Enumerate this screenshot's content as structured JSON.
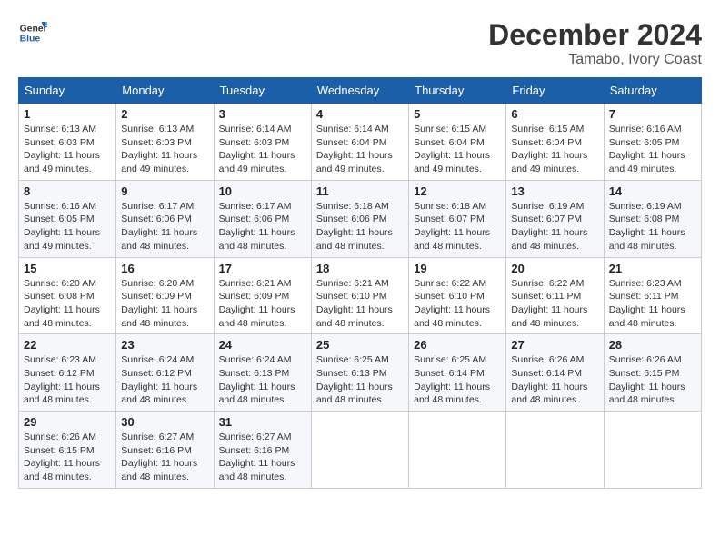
{
  "header": {
    "logo_line1": "General",
    "logo_line2": "Blue",
    "month_year": "December 2024",
    "location": "Tamabo, Ivory Coast"
  },
  "calendar": {
    "days_of_week": [
      "Sunday",
      "Monday",
      "Tuesday",
      "Wednesday",
      "Thursday",
      "Friday",
      "Saturday"
    ],
    "weeks": [
      [
        {
          "day": "1",
          "info": "Sunrise: 6:13 AM\nSunset: 6:03 PM\nDaylight: 11 hours\nand 49 minutes."
        },
        {
          "day": "2",
          "info": "Sunrise: 6:13 AM\nSunset: 6:03 PM\nDaylight: 11 hours\nand 49 minutes."
        },
        {
          "day": "3",
          "info": "Sunrise: 6:14 AM\nSunset: 6:03 PM\nDaylight: 11 hours\nand 49 minutes."
        },
        {
          "day": "4",
          "info": "Sunrise: 6:14 AM\nSunset: 6:04 PM\nDaylight: 11 hours\nand 49 minutes."
        },
        {
          "day": "5",
          "info": "Sunrise: 6:15 AM\nSunset: 6:04 PM\nDaylight: 11 hours\nand 49 minutes."
        },
        {
          "day": "6",
          "info": "Sunrise: 6:15 AM\nSunset: 6:04 PM\nDaylight: 11 hours\nand 49 minutes."
        },
        {
          "day": "7",
          "info": "Sunrise: 6:16 AM\nSunset: 6:05 PM\nDaylight: 11 hours\nand 49 minutes."
        }
      ],
      [
        {
          "day": "8",
          "info": "Sunrise: 6:16 AM\nSunset: 6:05 PM\nDaylight: 11 hours\nand 49 minutes."
        },
        {
          "day": "9",
          "info": "Sunrise: 6:17 AM\nSunset: 6:06 PM\nDaylight: 11 hours\nand 48 minutes."
        },
        {
          "day": "10",
          "info": "Sunrise: 6:17 AM\nSunset: 6:06 PM\nDaylight: 11 hours\nand 48 minutes."
        },
        {
          "day": "11",
          "info": "Sunrise: 6:18 AM\nSunset: 6:06 PM\nDaylight: 11 hours\nand 48 minutes."
        },
        {
          "day": "12",
          "info": "Sunrise: 6:18 AM\nSunset: 6:07 PM\nDaylight: 11 hours\nand 48 minutes."
        },
        {
          "day": "13",
          "info": "Sunrise: 6:19 AM\nSunset: 6:07 PM\nDaylight: 11 hours\nand 48 minutes."
        },
        {
          "day": "14",
          "info": "Sunrise: 6:19 AM\nSunset: 6:08 PM\nDaylight: 11 hours\nand 48 minutes."
        }
      ],
      [
        {
          "day": "15",
          "info": "Sunrise: 6:20 AM\nSunset: 6:08 PM\nDaylight: 11 hours\nand 48 minutes."
        },
        {
          "day": "16",
          "info": "Sunrise: 6:20 AM\nSunset: 6:09 PM\nDaylight: 11 hours\nand 48 minutes."
        },
        {
          "day": "17",
          "info": "Sunrise: 6:21 AM\nSunset: 6:09 PM\nDaylight: 11 hours\nand 48 minutes."
        },
        {
          "day": "18",
          "info": "Sunrise: 6:21 AM\nSunset: 6:10 PM\nDaylight: 11 hours\nand 48 minutes."
        },
        {
          "day": "19",
          "info": "Sunrise: 6:22 AM\nSunset: 6:10 PM\nDaylight: 11 hours\nand 48 minutes."
        },
        {
          "day": "20",
          "info": "Sunrise: 6:22 AM\nSunset: 6:11 PM\nDaylight: 11 hours\nand 48 minutes."
        },
        {
          "day": "21",
          "info": "Sunrise: 6:23 AM\nSunset: 6:11 PM\nDaylight: 11 hours\nand 48 minutes."
        }
      ],
      [
        {
          "day": "22",
          "info": "Sunrise: 6:23 AM\nSunset: 6:12 PM\nDaylight: 11 hours\nand 48 minutes."
        },
        {
          "day": "23",
          "info": "Sunrise: 6:24 AM\nSunset: 6:12 PM\nDaylight: 11 hours\nand 48 minutes."
        },
        {
          "day": "24",
          "info": "Sunrise: 6:24 AM\nSunset: 6:13 PM\nDaylight: 11 hours\nand 48 minutes."
        },
        {
          "day": "25",
          "info": "Sunrise: 6:25 AM\nSunset: 6:13 PM\nDaylight: 11 hours\nand 48 minutes."
        },
        {
          "day": "26",
          "info": "Sunrise: 6:25 AM\nSunset: 6:14 PM\nDaylight: 11 hours\nand 48 minutes."
        },
        {
          "day": "27",
          "info": "Sunrise: 6:26 AM\nSunset: 6:14 PM\nDaylight: 11 hours\nand 48 minutes."
        },
        {
          "day": "28",
          "info": "Sunrise: 6:26 AM\nSunset: 6:15 PM\nDaylight: 11 hours\nand 48 minutes."
        }
      ],
      [
        {
          "day": "29",
          "info": "Sunrise: 6:26 AM\nSunset: 6:15 PM\nDaylight: 11 hours\nand 48 minutes."
        },
        {
          "day": "30",
          "info": "Sunrise: 6:27 AM\nSunset: 6:16 PM\nDaylight: 11 hours\nand 48 minutes."
        },
        {
          "day": "31",
          "info": "Sunrise: 6:27 AM\nSunset: 6:16 PM\nDaylight: 11 hours\nand 48 minutes."
        },
        {
          "day": "",
          "info": ""
        },
        {
          "day": "",
          "info": ""
        },
        {
          "day": "",
          "info": ""
        },
        {
          "day": "",
          "info": ""
        }
      ]
    ]
  }
}
